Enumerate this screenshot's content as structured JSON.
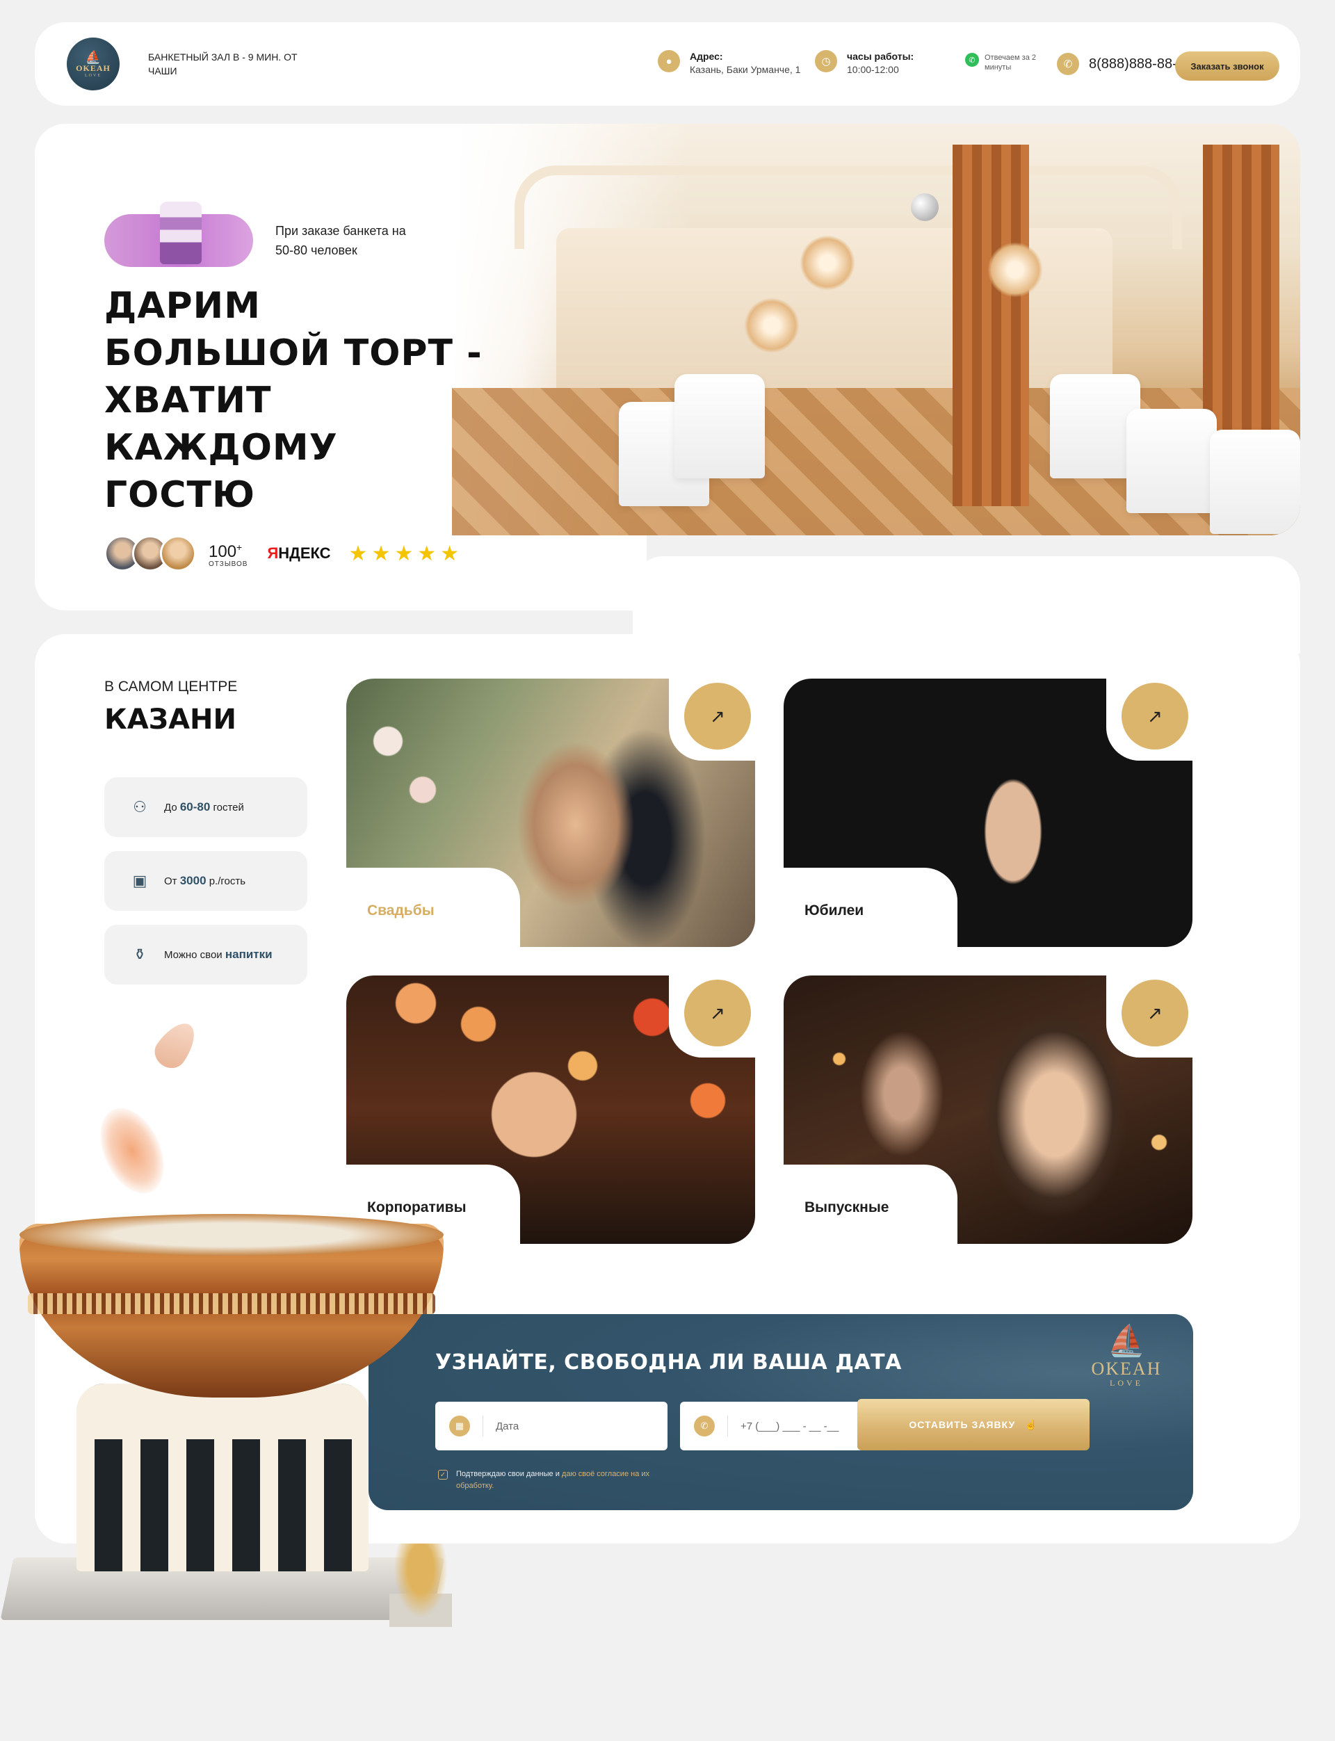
{
  "header": {
    "logo": {
      "title": "OKEAH",
      "subtitle": "LOVE"
    },
    "tagline": "БАНКЕТНЫЙ ЗАЛ В - 9 МИН. ОТ ЧАШИ",
    "address_label": "Адрес:",
    "address_value": "Казань, Баки Урманче, 1",
    "hours_label": "часы работы:",
    "hours_value": "10:00-12:00",
    "whatsapp_note": "Отвечаем за 2 минуты",
    "phone": "8(888)888-88-88",
    "call_button": "Заказать звонок"
  },
  "hero": {
    "offer_text": "При заказе банкета на 50-80 человек",
    "title": "ДАРИМ БОЛЬШОЙ ТОРТ - ХВАТИТ КАЖДОМУ ГОСТЮ",
    "reviews_count": "100",
    "reviews_plus": "+",
    "reviews_label": "ОТЗЫВОВ",
    "yandex_first": "Я",
    "yandex_rest": "НДЕКС",
    "stars": [
      "★",
      "★",
      "★",
      "★",
      "★"
    ],
    "rating_stars": 5
  },
  "location": {
    "small": "В САМОМ ЦЕНТРЕ",
    "big": "КАЗАНИ"
  },
  "features": [
    {
      "icon": "guests-icon",
      "prefix": "До",
      "highlight": "60-80",
      "suffix": "гостей"
    },
    {
      "icon": "wallet-icon",
      "prefix": "От",
      "highlight": "3000",
      "suffix": "р./гость"
    },
    {
      "icon": "bottle-icon",
      "prefix": "Можно свои",
      "highlight": "напитки",
      "suffix": ""
    }
  ],
  "events": [
    {
      "label": "Свадьбы",
      "arrow": "↗"
    },
    {
      "label": "Юбилеи",
      "arrow": "↗"
    },
    {
      "label": "Корпоративы",
      "arrow": "↗"
    },
    {
      "label": "Выпускные",
      "arrow": "↗"
    }
  ],
  "form": {
    "title": "УЗНАЙТЕ, СВОБОДНА ЛИ ВАША ДАТА",
    "logo_title": "OKEAH",
    "logo_subtitle": "LOVE",
    "date_placeholder": "Дата",
    "phone_placeholder": "+7 (___) ___ - __ -__",
    "submit": "ОСТАВИТЬ ЗАЯВКУ",
    "consent_text": "Подтверждаю свои данные и",
    "consent_link": "даю своё согласие на их обработку."
  },
  "colors": {
    "accent_gold": "#dbb56c",
    "dark_blue": "#2e4d62",
    "page_bg": "#f1f1f1"
  }
}
